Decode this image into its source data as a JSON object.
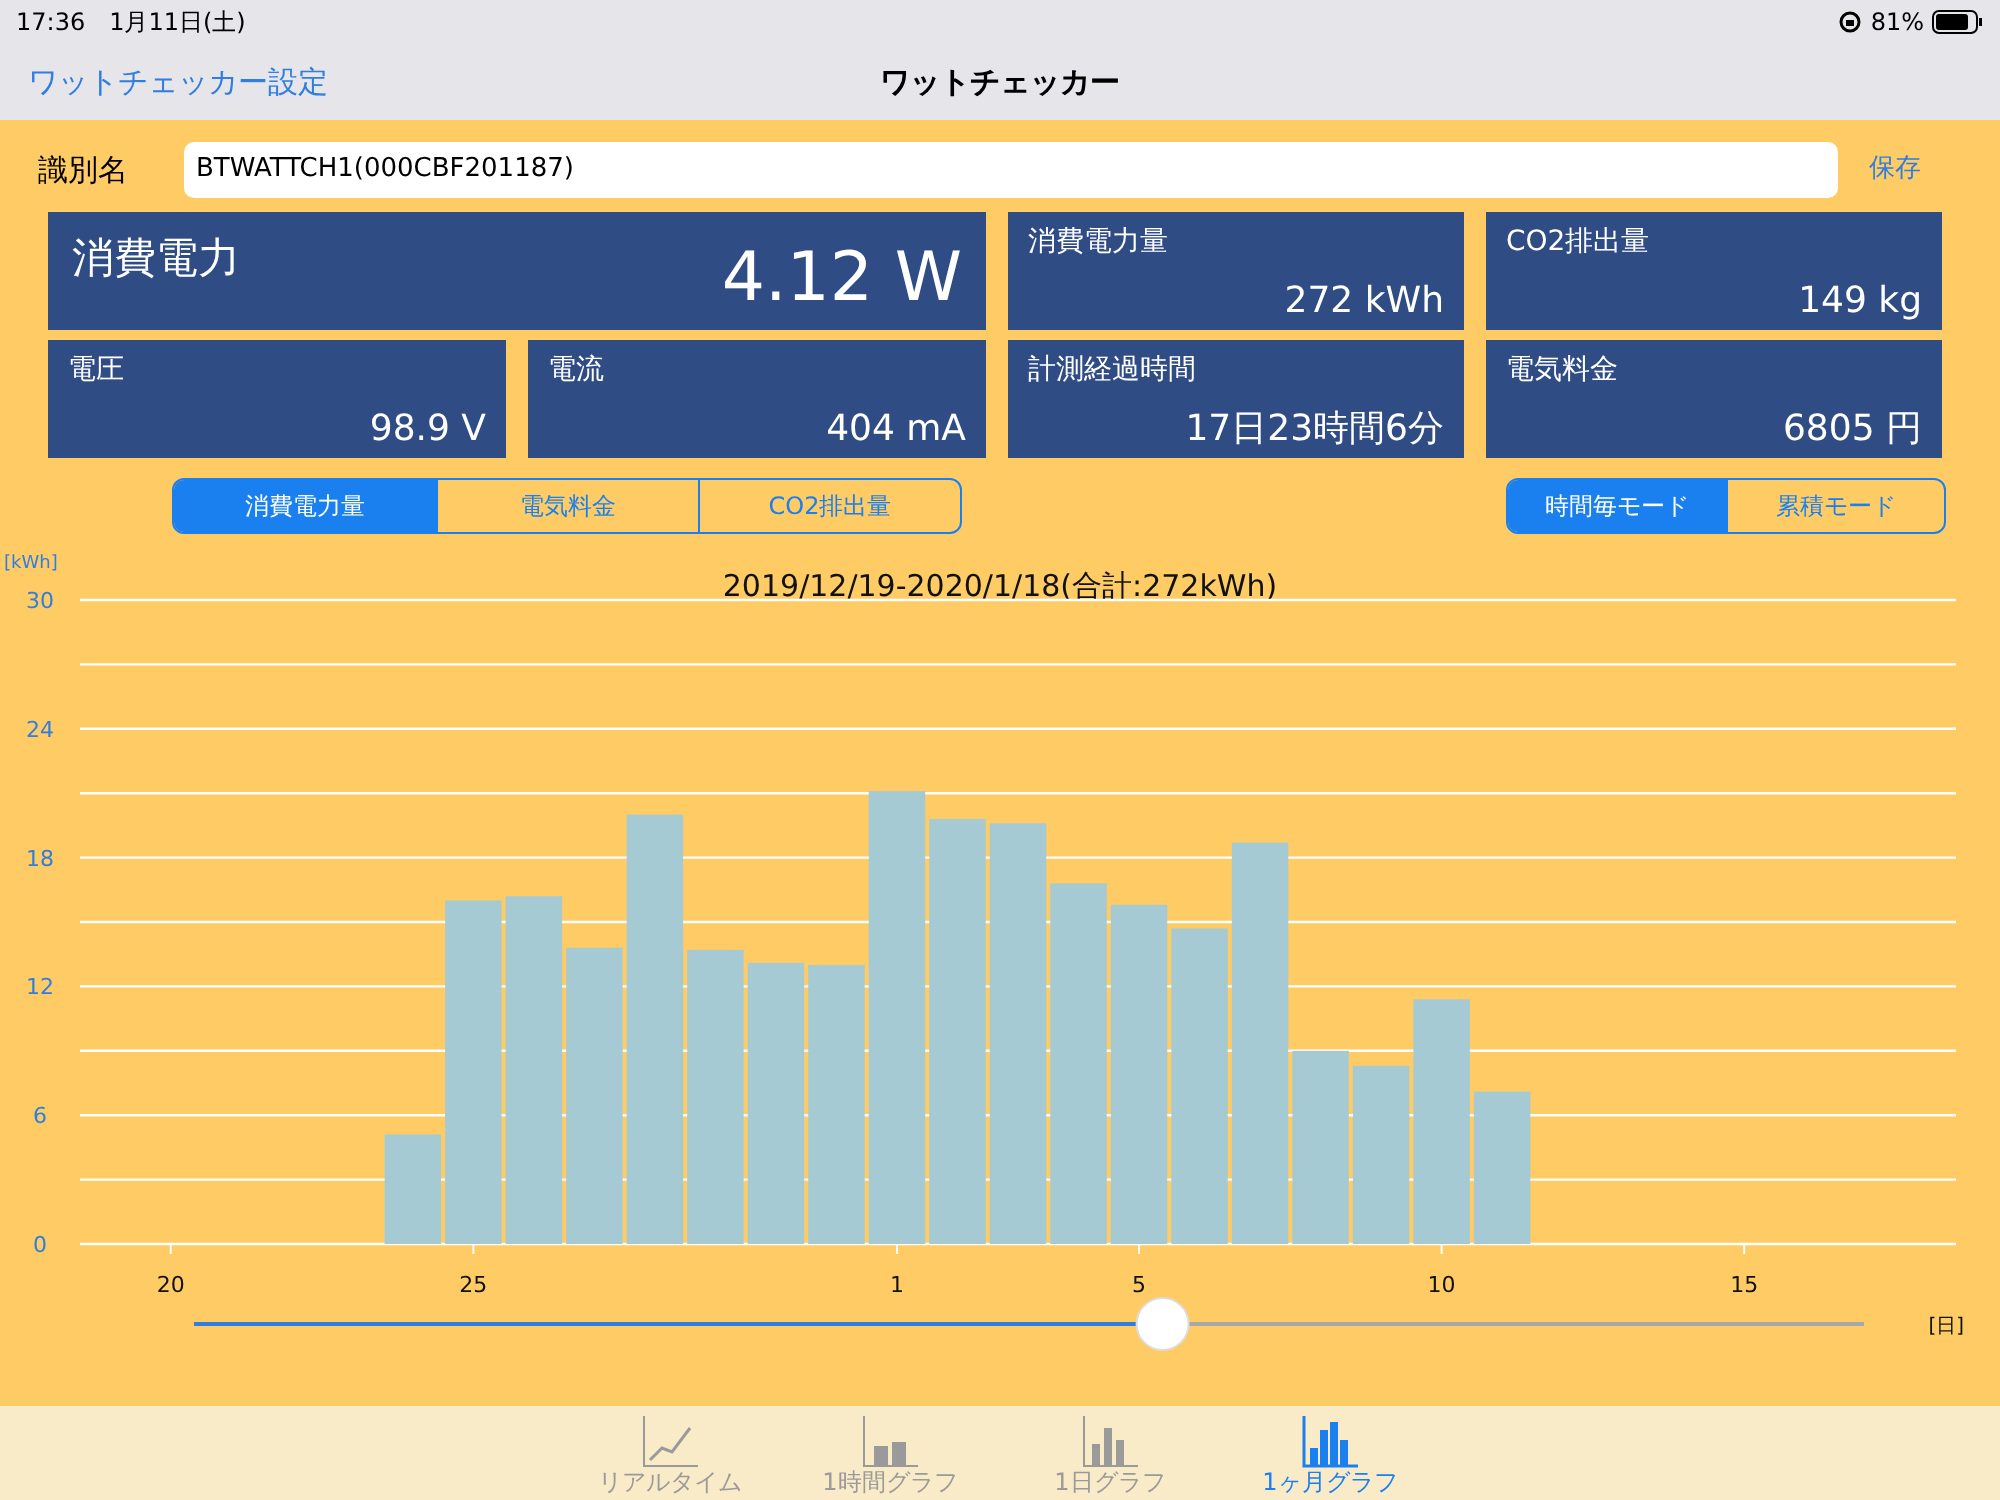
{
  "status_bar": {
    "time": "17:36",
    "date": "1月11日(土)",
    "battery": "81%"
  },
  "nav": {
    "back": "ワットチェッカー設定",
    "title": "ワットチェッカー"
  },
  "name_row": {
    "label": "識別名",
    "value": "BTWATTCH1(000CBF201187)",
    "save": "保存"
  },
  "metrics": [
    {
      "label": "消費電力",
      "value": "4.12 W",
      "kind": "large"
    },
    {
      "label": "消費電力量",
      "value": "272 kWh",
      "kind": "small"
    },
    {
      "label": "CO2排出量",
      "value": "149 kg",
      "kind": "small"
    },
    {
      "label": "電圧",
      "value": "98.9 V",
      "kind": "half"
    },
    {
      "label": "電流",
      "value": "404 mA",
      "kind": "half"
    },
    {
      "label": "計測経過時間",
      "value": "17日23時間6分",
      "kind": "small"
    },
    {
      "label": "電気料金",
      "value": "6805 円",
      "kind": "small"
    }
  ],
  "data_tabs": [
    {
      "label": "消費電力量",
      "selected": true
    },
    {
      "label": "電気料金",
      "selected": false
    },
    {
      "label": "CO2排出量",
      "selected": false
    }
  ],
  "mode_tabs": [
    {
      "label": "時間毎モード",
      "selected": true
    },
    {
      "label": "累積モード",
      "selected": false
    }
  ],
  "chart": {
    "chart_data": {
      "type": "bar",
      "title": "2019/12/19-2020/1/18(合計:272kWh)",
      "ylabel": "[kWh]",
      "xlabel": "[日]",
      "categories": [
        null,
        "20",
        null,
        null,
        null,
        null,
        "25",
        null,
        null,
        null,
        null,
        null,
        null,
        "1",
        null,
        null,
        null,
        "5",
        null,
        null,
        null,
        null,
        "10",
        null,
        null,
        null,
        null,
        "15",
        null,
        null,
        null
      ],
      "series": [
        {
          "color": "#a6cad3",
          "values": [
            null,
            null,
            null,
            null,
            null,
            5.1,
            16.0,
            16.2,
            13.8,
            20.0,
            13.7,
            13.1,
            13.0,
            21.1,
            19.8,
            19.6,
            16.8,
            15.8,
            14.7,
            18.7,
            9.0,
            8.3,
            11.4,
            7.1,
            null,
            null,
            null,
            null,
            null,
            null,
            null
          ]
        }
      ],
      "ylim": [
        0,
        30
      ],
      "yticks": [
        0,
        6,
        12,
        18,
        24,
        30
      ],
      "grid": true
    }
  },
  "slider": {
    "level": 0.58
  },
  "tab_bar": [
    {
      "label": "リアルタイム",
      "kind": "line",
      "selected": false
    },
    {
      "label": "1時間グラフ",
      "kind": "hour",
      "selected": false
    },
    {
      "label": "1日グラフ",
      "kind": "day",
      "selected": false
    },
    {
      "label": "1ヶ月グラフ",
      "kind": "month",
      "selected": true
    }
  ]
}
